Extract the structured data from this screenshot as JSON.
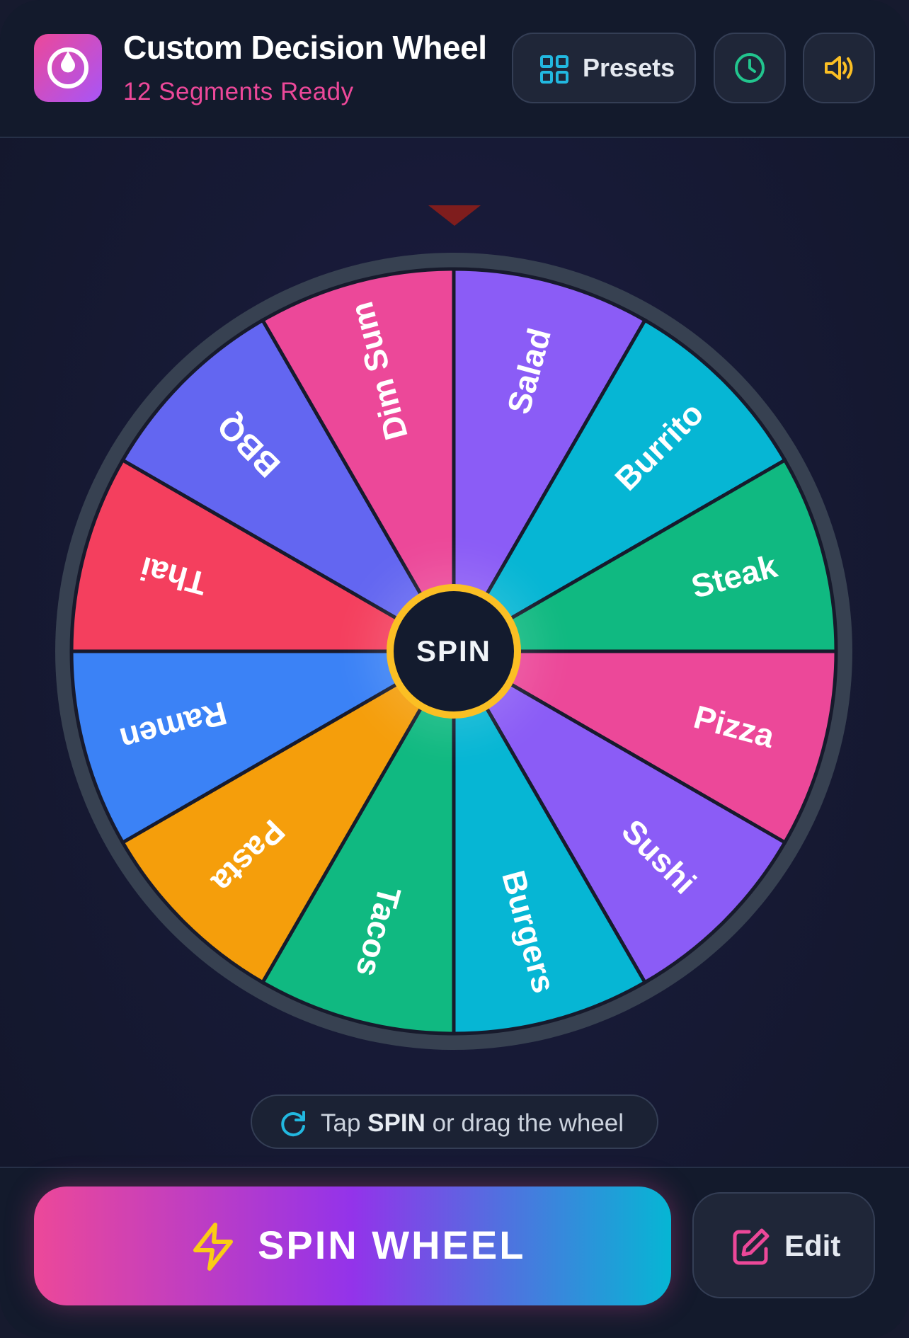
{
  "header": {
    "title": "Custom Decision Wheel",
    "subtitle": "12 Segments Ready",
    "presets_label": "Presets",
    "logo_icon": "wheel-logo-icon",
    "history_icon": "clock-icon",
    "sound_icon": "speaker-icon"
  },
  "wheel": {
    "segments": [
      {
        "label": "Salad",
        "color": "#8b5cf6"
      },
      {
        "label": "Burrito",
        "color": "#06b6d4"
      },
      {
        "label": "Steak",
        "color": "#10b981"
      },
      {
        "label": "Pizza",
        "color": "#ec4899"
      },
      {
        "label": "Sushi",
        "color": "#8b5cf6"
      },
      {
        "label": "Burgers",
        "color": "#06b6d4"
      },
      {
        "label": "Tacos",
        "color": "#10b981"
      },
      {
        "label": "Pasta",
        "color": "#f59e0b"
      },
      {
        "label": "Ramen",
        "color": "#3b82f6"
      },
      {
        "label": "Thai",
        "color": "#f43f5e"
      },
      {
        "label": "BBQ",
        "color": "#6366f1"
      },
      {
        "label": "Dim Sum",
        "color": "#ec4899"
      }
    ],
    "rim_color": "#374151",
    "hub_label": "SPIN",
    "hub_ring_color": "#fbbf24",
    "pointer_color": "#7f1d1d"
  },
  "hint": {
    "prefix": "Tap ",
    "bold": "SPIN",
    "suffix": " or drag the wheel",
    "icon": "refresh-icon"
  },
  "footer": {
    "spin_label": "SPIN WHEEL",
    "spin_icon": "lightning-icon",
    "edit_label": "Edit",
    "edit_icon": "edit-icon"
  }
}
